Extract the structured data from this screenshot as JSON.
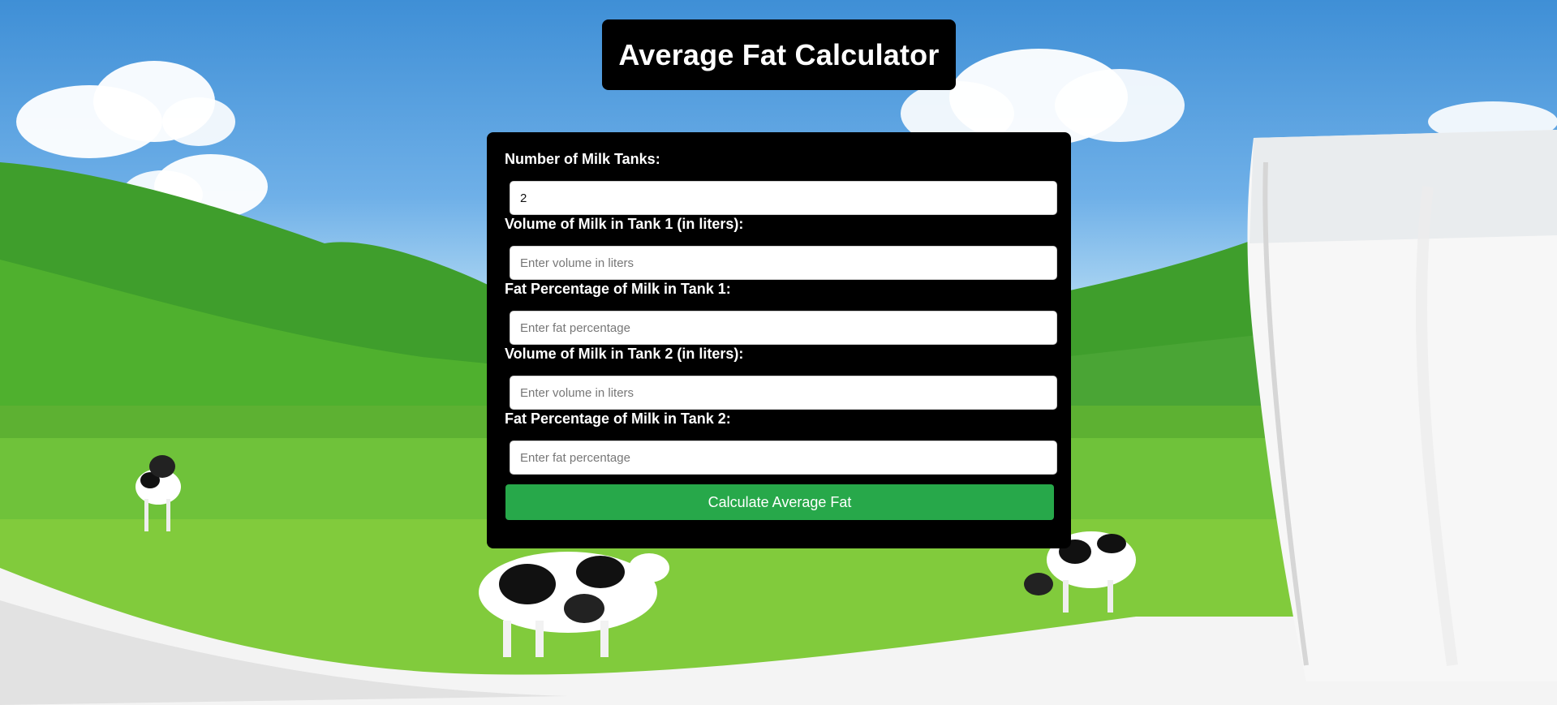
{
  "header": {
    "title": "Average Fat Calculator"
  },
  "form": {
    "tanks": {
      "label": "Number of Milk Tanks:",
      "value": "2"
    },
    "fields": [
      {
        "label": "Volume of Milk in Tank 1 (in liters):",
        "placeholder": "Enter volume in liters",
        "value": ""
      },
      {
        "label": "Fat Percentage of Milk in Tank 1:",
        "placeholder": "Enter fat percentage",
        "value": ""
      },
      {
        "label": "Volume of Milk in Tank 2 (in liters):",
        "placeholder": "Enter volume in liters",
        "value": ""
      },
      {
        "label": "Fat Percentage of Milk in Tank 2:",
        "placeholder": "Enter fat percentage",
        "value": ""
      }
    ],
    "submit_label": "Calculate Average Fat"
  },
  "colors": {
    "card_background": "#000000",
    "button_green": "#27a84a",
    "text_white": "#ffffff"
  }
}
